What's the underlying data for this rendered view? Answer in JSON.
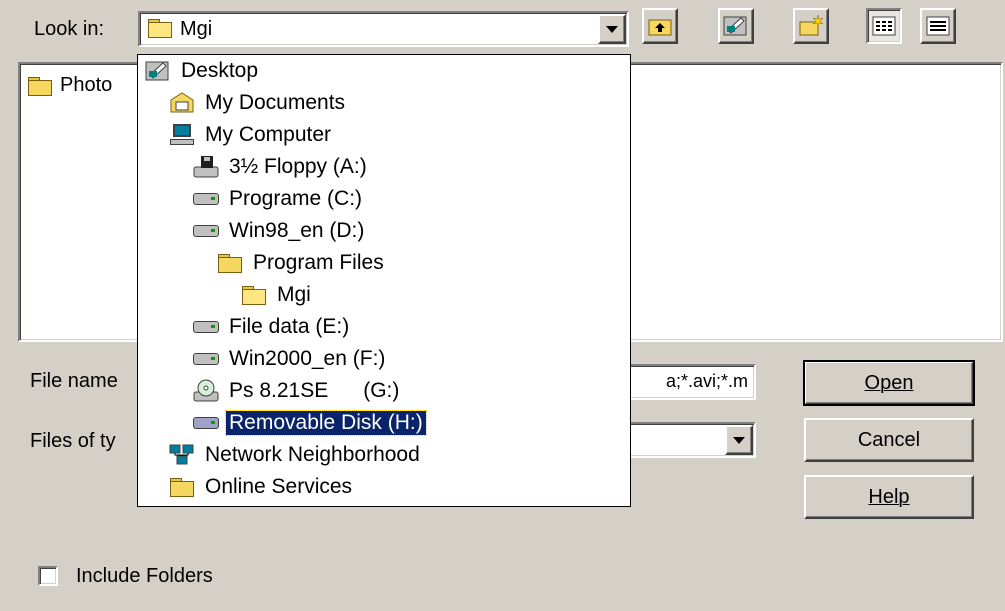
{
  "look_in": {
    "label": "Look in:",
    "value": "Mgi"
  },
  "toolbar": {
    "up_icon": "up-folder-icon",
    "desktop_icon": "desktop-icon",
    "new_folder_icon": "new-folder-icon",
    "list_icon": "list-view-icon",
    "details_icon": "details-view-icon"
  },
  "file_list": {
    "items": [
      {
        "label": "Photo"
      }
    ]
  },
  "dropdown": {
    "items": [
      {
        "label": "Desktop",
        "icon": "desktop-icon"
      },
      {
        "label": "My Documents",
        "icon": "my-documents-icon"
      },
      {
        "label": "My Computer",
        "icon": "computer-icon"
      },
      {
        "label": "3½ Floppy (A:)",
        "icon": "floppy-drive-icon"
      },
      {
        "label": "Programe (C:)",
        "icon": "hard-drive-icon"
      },
      {
        "label": "Win98_en (D:)",
        "icon": "hard-drive-icon"
      },
      {
        "label": "Program Files",
        "icon": "folder-icon"
      },
      {
        "label": "Mgi",
        "icon": "open-folder-icon"
      },
      {
        "label": "File data (E:)",
        "icon": "hard-drive-icon"
      },
      {
        "label": "Win2000_en (F:)",
        "icon": "hard-drive-icon"
      },
      {
        "label": "Ps 8.21SE      (G:)",
        "icon": "cd-drive-icon"
      },
      {
        "label": "Removable Disk (H:)",
        "icon": "removable-drive-icon"
      },
      {
        "label": "Network Neighborhood",
        "icon": "network-icon"
      },
      {
        "label": "Online Services",
        "icon": "folder-icon"
      }
    ]
  },
  "file_name": {
    "label": "File name",
    "value": "a;*.avi;*.m"
  },
  "files_of_type": {
    "label": "Files of ty"
  },
  "buttons": {
    "open": "Open",
    "cancel": "Cancel",
    "help": "Help"
  },
  "include_folders": {
    "label": "Include Folders",
    "checked": false
  }
}
